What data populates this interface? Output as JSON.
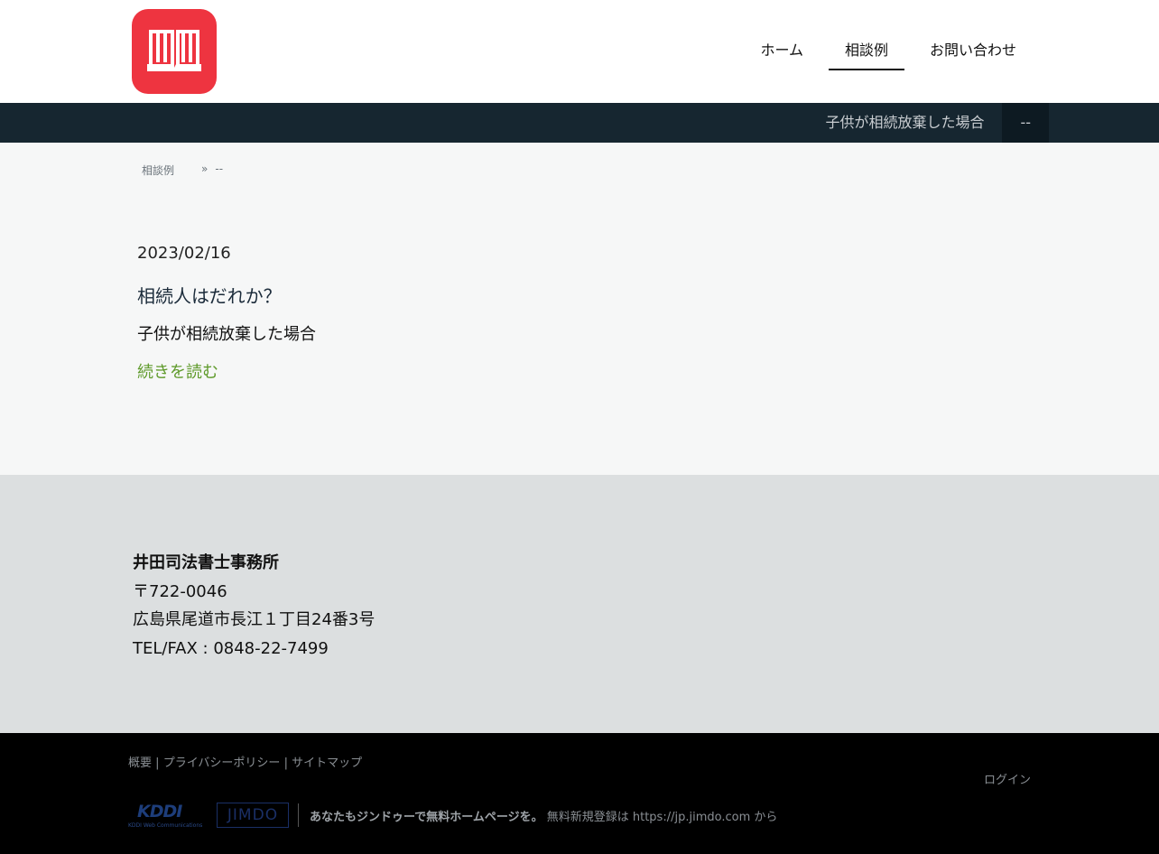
{
  "nav": {
    "items": [
      {
        "label": "ホーム"
      },
      {
        "label": "相談例"
      },
      {
        "label": "お問い合わせ"
      }
    ],
    "active_index": 1
  },
  "subnav": {
    "items": [
      {
        "label": "子供が相続放棄した場合"
      },
      {
        "label": "--"
      }
    ]
  },
  "breadcrumb": {
    "parent": "相談例",
    "separator": "»",
    "current": "--"
  },
  "post": {
    "date": "2023/02/16",
    "title": "相続人はだれか？",
    "excerpt": "子供が相続放棄した場合",
    "read_more": "続きを読む"
  },
  "office": {
    "name": "井田司法書士事務所",
    "postal": "〒722-0046",
    "address": "広島県尾道市長江１丁目24番3号",
    "tel": "TEL/FAX : 0848-22-7499"
  },
  "footer": {
    "links": [
      "概要",
      "プライバシーポリシー",
      "サイトマップ"
    ],
    "link_separator": "|",
    "login": "ログイン",
    "kddi_logo_text": "KDDI",
    "kddi_sub_text": "KDDI Web Communications",
    "jimdo_logo_text": "JIMDO",
    "promo_bold": "あなたもジンドゥーで無料ホームページを。",
    "promo_text": "無料新規登録は",
    "promo_url": "https://jp.jimdo.com",
    "promo_suffix": "から"
  },
  "colors": {
    "logo_red": "#ee3440",
    "subnav_bg": "#162630",
    "read_more_green": "#5e9a2a",
    "info_bg": "#dcdfe0",
    "footer_bg": "#000000"
  }
}
